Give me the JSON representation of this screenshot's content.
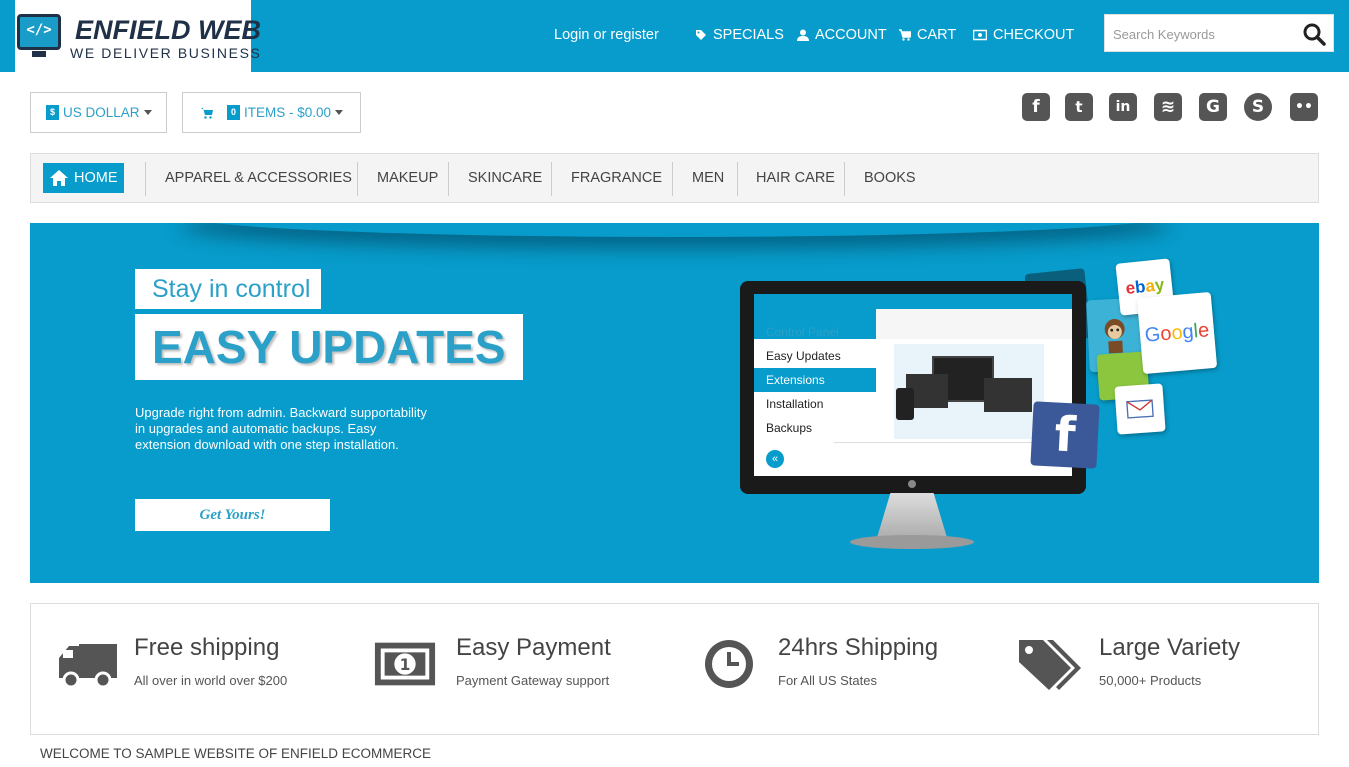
{
  "brand": {
    "name": "ENFIELD WEB",
    "tagline": "WE DELIVER BUSINESS",
    "logo_glyph": "</>"
  },
  "header": {
    "login": "Login or register",
    "links": [
      {
        "label": "SPECIALS",
        "icon": "tag-icon"
      },
      {
        "label": "ACCOUNT",
        "icon": "user-icon"
      },
      {
        "label": "CART",
        "icon": "cart-icon"
      },
      {
        "label": "CHECKOUT",
        "icon": "credit-card-icon"
      }
    ],
    "search_placeholder": "Search Keywords"
  },
  "currency": {
    "symbol": "$",
    "label": "US DOLLAR"
  },
  "cart": {
    "count": "0",
    "label": "ITEMS - $0.00"
  },
  "social": [
    {
      "name": "facebook-icon",
      "glyph": "f"
    },
    {
      "name": "twitter-icon",
      "glyph": "t"
    },
    {
      "name": "linkedin-icon",
      "glyph": "in"
    },
    {
      "name": "rss-icon",
      "glyph": "≋"
    },
    {
      "name": "google-icon",
      "glyph": "G"
    },
    {
      "name": "skype-icon",
      "glyph": "S"
    },
    {
      "name": "flickr-icon",
      "glyph": "••"
    }
  ],
  "nav": {
    "home": "HOME",
    "items": [
      "APPAREL & ACCESSORIES",
      "MAKEUP",
      "SKINCARE",
      "FRAGRANCE",
      "MEN",
      "HAIR CARE",
      "BOOKS"
    ]
  },
  "hero": {
    "kicker": "Stay in control",
    "headline": "EASY UPDATES",
    "text": "Upgrade right from admin. Backward supportability in upgrades and automatic backups. Easy extension download with one step installation.",
    "cta": "Get Yours!",
    "screen_menu": [
      "Control Panel",
      "Easy Updates",
      "Extensions",
      "Installation",
      "Backups"
    ],
    "tiles": [
      "ebay",
      "Google",
      "f"
    ]
  },
  "features": [
    {
      "icon": "truck-icon",
      "title": "Free shipping",
      "sub": "All over in world over $200"
    },
    {
      "icon": "money-icon",
      "title": "Easy Payment",
      "sub": "Payment Gateway support"
    },
    {
      "icon": "clock-icon",
      "title": "24hrs Shipping",
      "sub": "For All US States"
    },
    {
      "icon": "tags-icon",
      "title": "Large Variety",
      "sub": "50,000+ Products"
    }
  ],
  "welcome": "WELCOME TO SAMPLE WEBSITE OF ENFIELD ECOMMERCE",
  "colors": {
    "accent": "#079ccb",
    "dark": "#1f3047",
    "icon_gray": "#555555"
  }
}
